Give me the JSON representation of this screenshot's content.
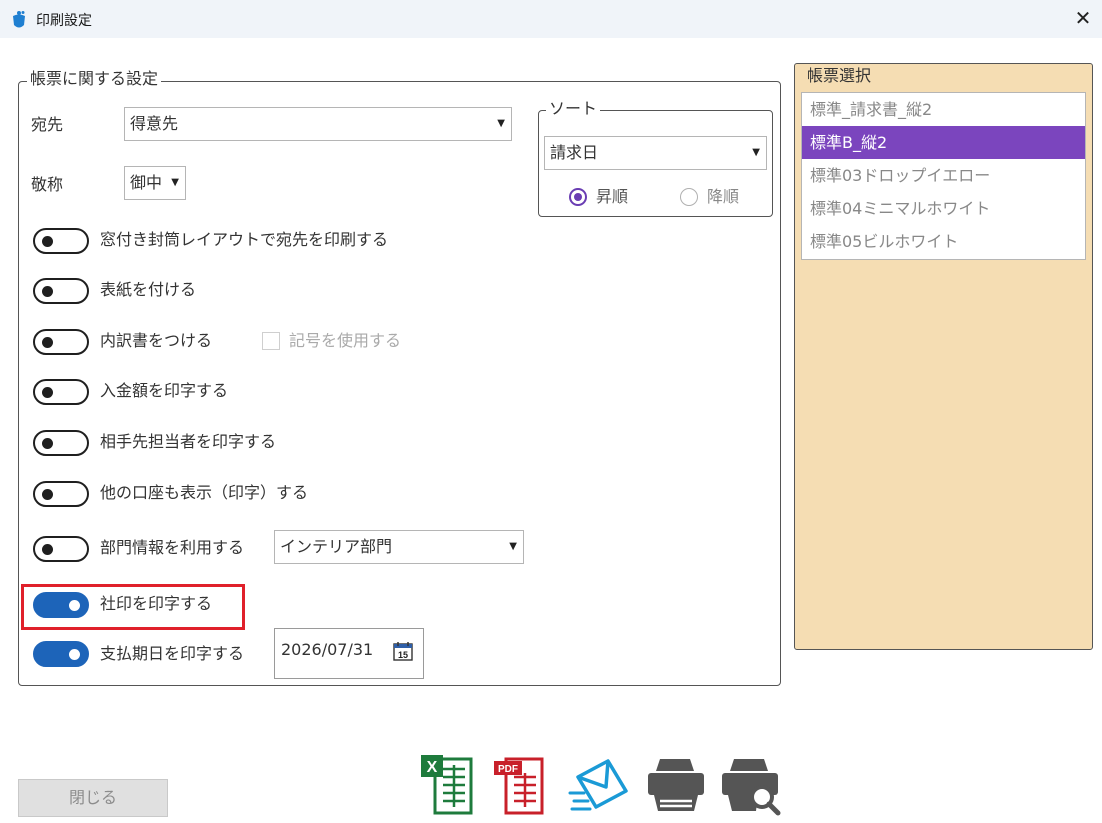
{
  "window": {
    "title": "印刷設定"
  },
  "form_group": {
    "legend": "帳票に関する設定",
    "destination_label": "宛先",
    "destination_value": "得意先",
    "honorific_label": "敬称",
    "honorific_value": "御中",
    "sort": {
      "legend": "ソート",
      "field_value": "請求日",
      "ascending_label": "昇順",
      "descending_label": "降順",
      "selected": "昇順"
    },
    "toggles": [
      {
        "label": "窓付き封筒レイアウトで宛先を印刷する",
        "on": false
      },
      {
        "label": "表紙を付ける",
        "on": false
      },
      {
        "label": "内訳書をつける",
        "on": false
      },
      {
        "label": "入金額を印字する",
        "on": false
      },
      {
        "label": "相手先担当者を印字する",
        "on": false
      },
      {
        "label": "他の口座も表示（印字）する",
        "on": false
      },
      {
        "label": "部門情報を利用する",
        "on": false
      },
      {
        "label": "社印を印字する",
        "on": true
      },
      {
        "label": "支払期日を印字する",
        "on": true
      }
    ],
    "symbol_checkbox_label": "記号を使用する",
    "department_value": "インテリア部門",
    "due_date_value": "2026/07/31",
    "calendar_day": "15"
  },
  "form_select": {
    "legend": "帳票選択",
    "items": [
      "標準_請求書_縦2",
      "標準B_縦2",
      "標準03ドロップイエロー",
      "標準04ミニマルホワイト",
      "標準05ビルホワイト"
    ],
    "selected": "標準B_縦2"
  },
  "footer": {
    "close_label": "閉じる",
    "pdf_text": "PDF",
    "excel_text": "X"
  },
  "colors": {
    "accent_purple": "#7b45be",
    "toggle_on": "#1d64b9",
    "highlight_red": "#e0202a",
    "panel_bg": "#f5ddb3",
    "excel_green": "#1e7b3c",
    "pdf_red": "#c8202a",
    "mail_blue": "#1a9ad6"
  },
  "icons": [
    "app-logo-icon",
    "close-icon",
    "dropdown-arrow-icon",
    "calendar-icon",
    "excel-export-icon",
    "pdf-export-icon",
    "mail-icon",
    "printer-icon",
    "print-preview-icon"
  ]
}
